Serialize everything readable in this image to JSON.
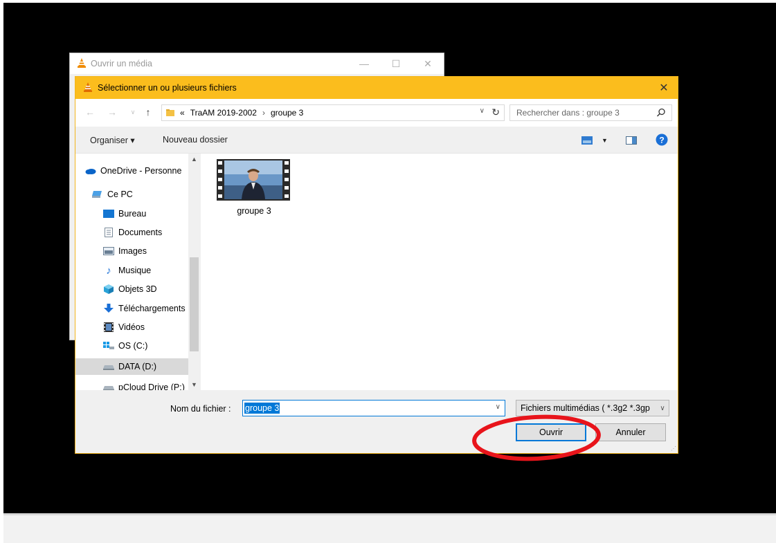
{
  "back_window": {
    "title": "Ouvrir un média"
  },
  "dialog": {
    "title": "Sélectionner un ou plusieurs fichiers",
    "close_symbol": "✕"
  },
  "navigation": {
    "address_prefix": "«",
    "breadcrumb": [
      "TraAM 2019-2002",
      "groupe 3"
    ],
    "separator": "›",
    "search_placeholder": "Rechercher dans : groupe 3"
  },
  "toolbar": {
    "organise_label": "Organiser ▾",
    "new_folder_label": "Nouveau dossier"
  },
  "nav_pane": {
    "items": [
      {
        "label": "OneDrive - Personnel",
        "icon": "cloud-icon"
      },
      {
        "label": "Ce PC",
        "icon": "computer-icon"
      },
      {
        "label": "Bureau",
        "icon": "desktop-icon"
      },
      {
        "label": "Documents",
        "icon": "document-icon"
      },
      {
        "label": "Images",
        "icon": "image-icon"
      },
      {
        "label": "Musique",
        "icon": "music-icon"
      },
      {
        "label": "Objets 3D",
        "icon": "cube-icon"
      },
      {
        "label": "Téléchargements",
        "icon": "download-icon"
      },
      {
        "label": "Vidéos",
        "icon": "video-icon"
      },
      {
        "label": "OS (C:)",
        "icon": "drive-icon"
      },
      {
        "label": "DATA (D:)",
        "icon": "drive-icon",
        "selected": true
      },
      {
        "label": "pCloud Drive (P:)",
        "icon": "drive-icon"
      }
    ]
  },
  "files": [
    {
      "name": "groupe 3",
      "icon": "video-file-icon"
    }
  ],
  "bottom": {
    "filename_label": "Nom du fichier :",
    "filename_value": "groupe 3",
    "filetype_value": "Fichiers multimédias ( *.3g2 *.3gp",
    "open_label": "Ouvrir",
    "cancel_label": "Annuler"
  },
  "colors": {
    "title_accent": "#fbbd1d",
    "selection_blue": "#0078d7",
    "annotation_red": "#e8141b"
  }
}
